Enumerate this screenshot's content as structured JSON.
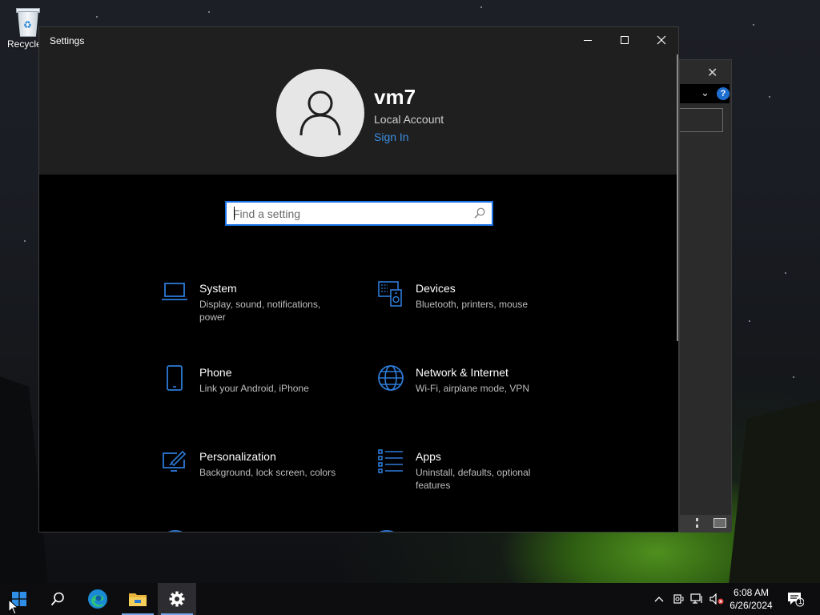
{
  "desktop": {
    "recycle_bin_label": "Recycle"
  },
  "window": {
    "title": "Settings",
    "minimize_label": "Minimize",
    "maximize_label": "Maximize",
    "close_label": "Close"
  },
  "account": {
    "name": "vm7",
    "type": "Local Account",
    "sign_in": "Sign In"
  },
  "search": {
    "placeholder": "Find a setting"
  },
  "categories": [
    {
      "name": "System",
      "description": "Display, sound, notifications, power",
      "icon": "laptop-icon"
    },
    {
      "name": "Devices",
      "description": "Bluetooth, printers, mouse",
      "icon": "keyboard-speaker-icon"
    },
    {
      "name": "Phone",
      "description": "Link your Android, iPhone",
      "icon": "phone-icon"
    },
    {
      "name": "Network & Internet",
      "description": "Wi-Fi, airplane mode, VPN",
      "icon": "globe-icon"
    },
    {
      "name": "Personalization",
      "description": "Background, lock screen, colors",
      "icon": "paintbrush-screen-icon"
    },
    {
      "name": "Apps",
      "description": "Uninstall, defaults, optional features",
      "icon": "apps-list-icon"
    }
  ],
  "taskbar": {
    "items": [
      "start",
      "search",
      "edge",
      "file-explorer",
      "settings"
    ],
    "active": "settings"
  },
  "tray": {
    "time": "6:08 AM",
    "date": "6/26/2024",
    "notification_count": "1"
  },
  "colors": {
    "accent": "#1a73e8",
    "link": "#3b8fe0",
    "icon_blue": "#2d7bd8"
  }
}
